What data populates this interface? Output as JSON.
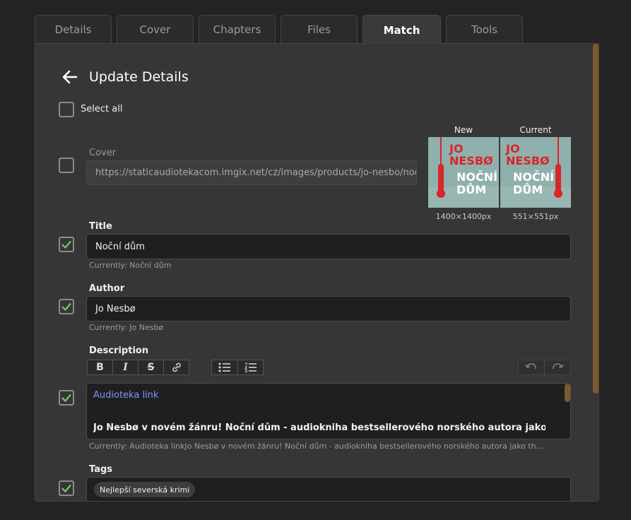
{
  "tabs": [
    {
      "label": "Details"
    },
    {
      "label": "Cover"
    },
    {
      "label": "Chapters"
    },
    {
      "label": "Files"
    },
    {
      "label": "Match"
    },
    {
      "label": "Tools"
    }
  ],
  "active_tab": "Match",
  "header": {
    "title": "Update Details"
  },
  "select_all": {
    "label": "Select all",
    "checked": false
  },
  "cover": {
    "label": "Cover",
    "checked": false,
    "url": "https://staticaudiotekacom.imgix.net/cz/images/products/jo-nesbo/nocni-dum",
    "new_label": "New",
    "current_label": "Current",
    "new_size": "1400×1400px",
    "current_size": "551×551px",
    "art_author": "JO NESBØ",
    "art_title_1": "NOČNÍ",
    "art_title_2": "DŮM",
    "art_color": "#8fb0ad",
    "art_accent": "#d8262a"
  },
  "title": {
    "label": "Title",
    "checked": true,
    "value": "Noční dům",
    "currently": "Currently: Noční dům"
  },
  "author": {
    "label": "Author",
    "checked": true,
    "value": "Jo Nesbø",
    "currently": "Currently: Jo Nesbø"
  },
  "description": {
    "label": "Description",
    "checked": true,
    "link_text": "Audioteka link",
    "body": "Jo Nesbø v novém žánru! Noční dům - audiokniha bestsellerového norského autora jako thriller s hororovými",
    "currently": "Currently: Audioteka linkJo Nesbø v novém žánru! Noční dům - audiokniha bestsellerového norského autora jako th..."
  },
  "tags": {
    "label": "Tags",
    "checked": true,
    "items": [
      "Nejlepší severská krimi"
    ]
  },
  "colors": {
    "accent_check": "#6fcf6a",
    "link": "#7f95ff",
    "scroll": "#7a5a2e"
  }
}
